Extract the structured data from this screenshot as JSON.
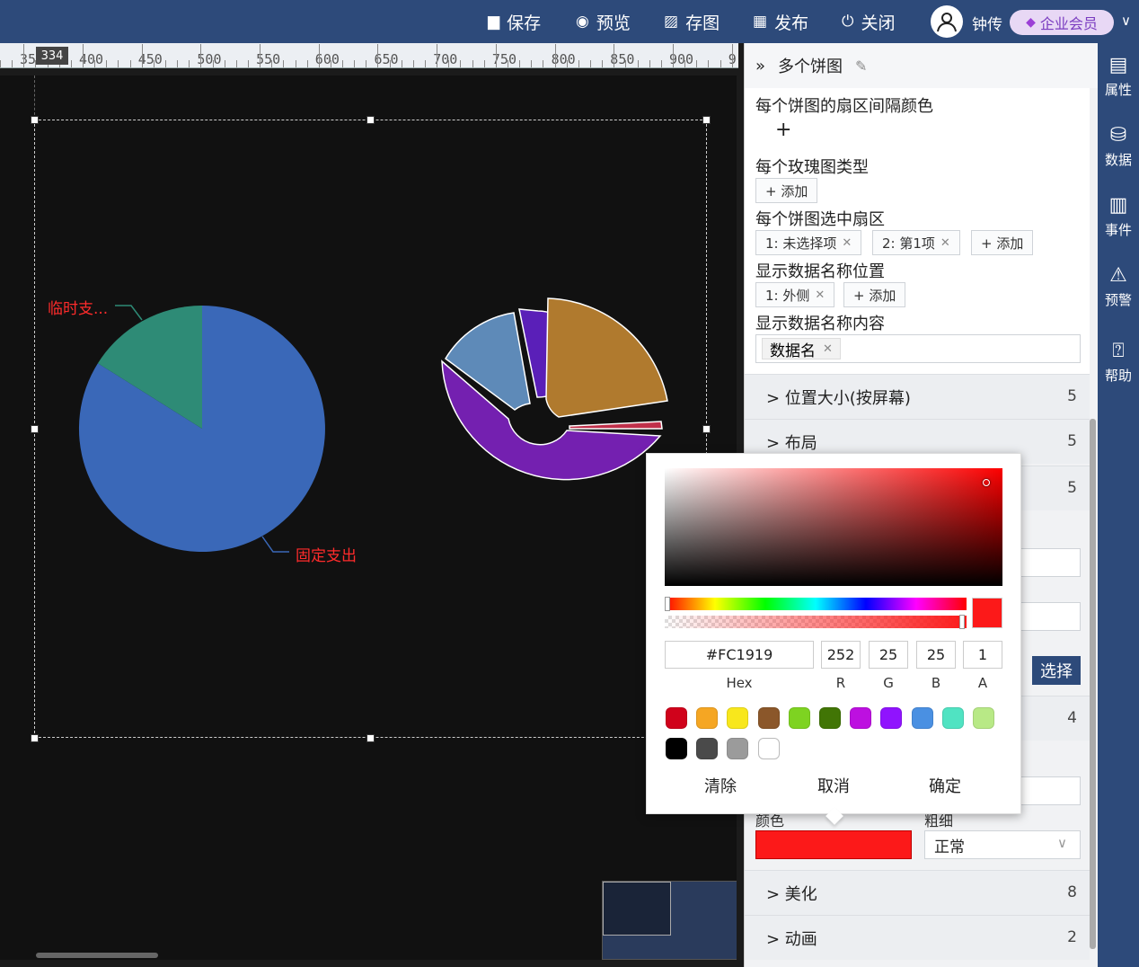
{
  "toolbar": {
    "save": "保存",
    "preview": "预览",
    "save_image": "存图",
    "publish": "发布",
    "close": "关闭",
    "user_name": "钟传",
    "membership": "企业会员"
  },
  "ruler": {
    "badge": "334",
    "ticks": [
      "35",
      "400",
      "450",
      "500",
      "550",
      "600",
      "650",
      "700",
      "750",
      "800",
      "850",
      "900",
      "9"
    ]
  },
  "canvas": {
    "pie1_label_top": "临时支...",
    "pie1_label_bottom": "固定支出"
  },
  "panel": {
    "title": "多个饼图",
    "sector_gap_color_label": "每个饼图的扇区间隔颜色",
    "plus": "+",
    "rose_type_label": "每个玫瑰图类型",
    "add": "+ 添加",
    "selected_sector_label": "每个饼图选中扇区",
    "sector_chip_1": "1: 未选择项",
    "sector_chip_2": "2: 第1项",
    "name_position_label": "显示数据名称位置",
    "position_chip_1": "1: 外侧",
    "name_content_label": "显示数据名称内容",
    "content_tag": "数据名",
    "sections": [
      {
        "label": "> 位置大小(按屏幕)",
        "count": "5"
      },
      {
        "label": "> 布局",
        "count": "5"
      },
      {
        "label": "",
        "count": "5"
      },
      {
        "label": "",
        "count": "4"
      },
      {
        "label": "> 美化",
        "count": "8"
      },
      {
        "label": "> 动画",
        "count": "2"
      }
    ],
    "choose_button": "选择",
    "color_label": "颜色",
    "thickness_label": "粗细",
    "thickness_value": "正常"
  },
  "sidenav": {
    "items": [
      "属性",
      "数据",
      "事件",
      "预警",
      "帮助"
    ]
  },
  "color_picker": {
    "hex": "#FC1919",
    "r": "252",
    "g": "25",
    "b": "25",
    "a": "1",
    "hex_label": "Hex",
    "r_label": "R",
    "g_label": "G",
    "b_label": "B",
    "a_label": "A",
    "swatches": [
      "#d0021b",
      "#f5a623",
      "#f8e71c",
      "#8b572a",
      "#7ed321",
      "#417505",
      "#bd10e0",
      "#9013fe",
      "#4a90e2",
      "#50e3c2",
      "#b8e986",
      "#000000",
      "#4a4a4a",
      "#9b9b9b",
      "#ffffff"
    ],
    "clear": "清除",
    "cancel": "取消",
    "confirm": "确定"
  }
}
